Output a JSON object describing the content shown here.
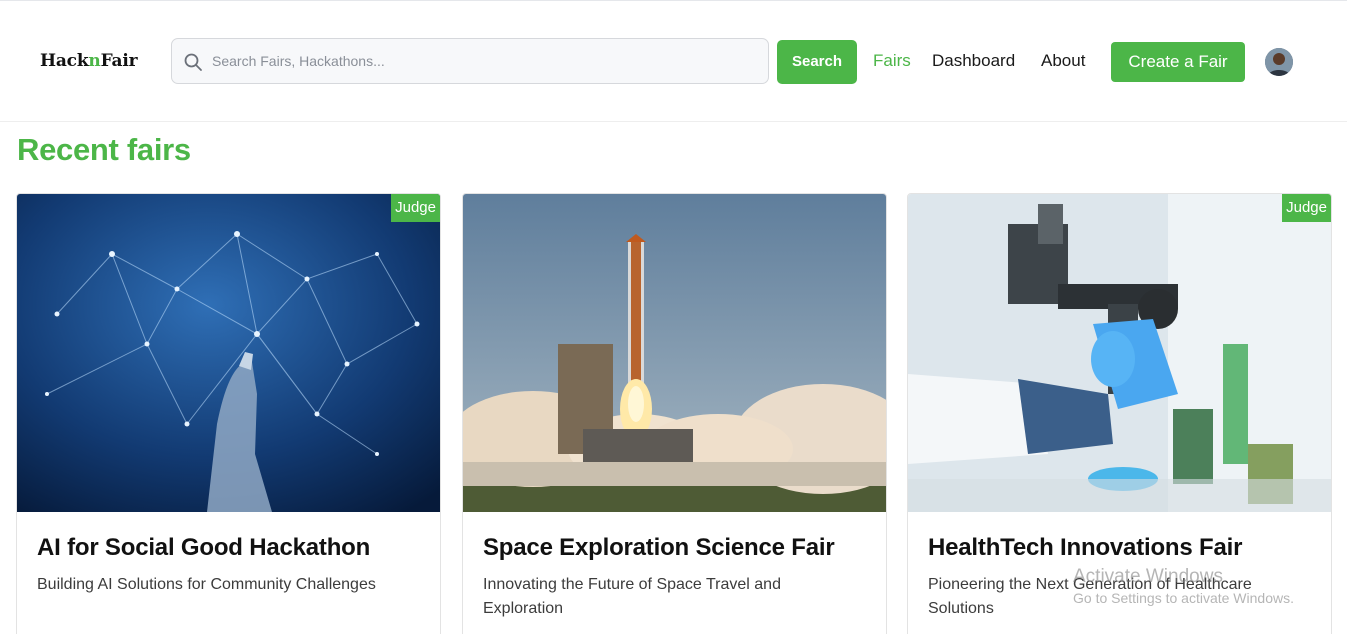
{
  "header": {
    "logo_prefix": "Hack",
    "logo_accent": "n",
    "logo_suffix": "Fair",
    "search": {
      "placeholder": "Search Fairs, Hackathons...",
      "value": ""
    },
    "search_button": "Search",
    "nav": {
      "fairs": "Fairs",
      "dashboard": "Dashboard",
      "about": "About"
    },
    "create_button": "Create a Fair"
  },
  "main": {
    "title": "Recent fairs",
    "cards": [
      {
        "title": "AI for Social Good Hackathon",
        "description": "Building AI Solutions for Community Challenges",
        "badge": "Judge",
        "image": "ai-network"
      },
      {
        "title": "Space Exploration Science Fair",
        "description": "Innovating the Future of Space Travel and Exploration",
        "badge": "",
        "image": "rocket-launch"
      },
      {
        "title": "HealthTech Innovations Fair",
        "description": "Pioneering the Next Generation of Healthcare Solutions",
        "badge": "Judge",
        "image": "lab-microscope"
      }
    ]
  },
  "watermark": {
    "title": "Activate Windows",
    "subtitle": "Go to Settings to activate Windows."
  },
  "colors": {
    "accent": "#4cb648",
    "text": "#1a1a1a",
    "muted": "#3c3c3c"
  }
}
